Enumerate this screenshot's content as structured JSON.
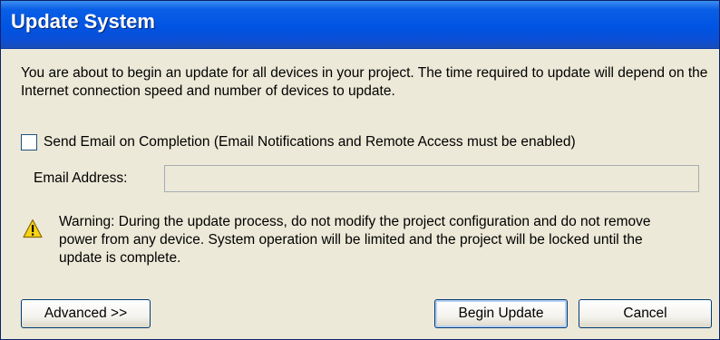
{
  "window": {
    "title": "Update System"
  },
  "intro": {
    "text": "You are about to begin an update for all devices in your project.  The time required to update will depend on the Internet connection speed and number of devices to update."
  },
  "email_notification": {
    "checkbox_label": "Send Email on Completion (Email Notifications and Remote Access must be enabled)",
    "checked": false,
    "email_label": "Email Address:",
    "email_value": ""
  },
  "warning": {
    "icon": "warning-triangle-icon",
    "text": "Warning: During the update process, do not modify the project configuration and do not remove power from any device.  System operation will be limited and the project will be locked until the update is complete."
  },
  "buttons": {
    "advanced": "Advanced >>",
    "begin_update": "Begin Update",
    "cancel": "Cancel"
  }
}
